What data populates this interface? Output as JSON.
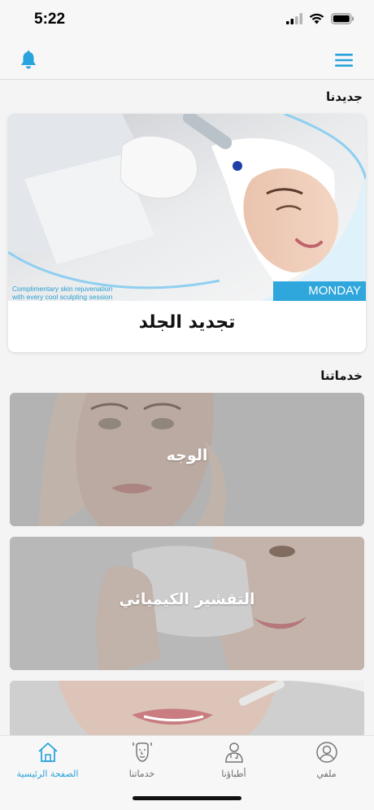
{
  "status_bar": {
    "time": "5:22"
  },
  "header": {
    "bell_icon": "bell-icon",
    "menu_icon": "hamburger-menu-icon",
    "accent": "#29a3db"
  },
  "new_section": {
    "title": "جديدنا",
    "featured": {
      "title": "تجديد الجلد",
      "promo_line1": "Complimentary skin rejuvenation",
      "promo_line2": "with every cool sculpting session",
      "badge": "MONDAY"
    }
  },
  "services_section": {
    "title": "خدماتنا",
    "items": [
      {
        "label": "الوجه"
      },
      {
        "label": "التقشير الكيميائي"
      },
      {
        "label": ""
      }
    ]
  },
  "bottom_nav": {
    "items": [
      {
        "label": "الصفحة الرئيسية",
        "icon": "home-icon",
        "active": true
      },
      {
        "label": "خدماتنا",
        "icon": "face-icon",
        "active": false
      },
      {
        "label": "أطباؤنا",
        "icon": "doctor-icon",
        "active": false
      },
      {
        "label": "ملفي",
        "icon": "profile-icon",
        "active": false
      }
    ]
  }
}
